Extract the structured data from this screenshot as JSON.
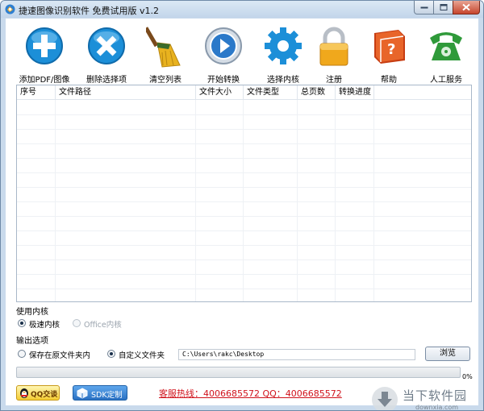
{
  "window": {
    "title": "捷速图像识别软件 免费试用版 v1.2"
  },
  "toolbar": [
    {
      "label": "添加PDF/图像",
      "icon": "add-icon",
      "color": "#1c8fd8"
    },
    {
      "label": "删除选择项",
      "icon": "delete-icon",
      "color": "#1c8fd8"
    },
    {
      "label": "清空列表",
      "icon": "broom-icon",
      "color": "#e8b21f"
    },
    {
      "label": "开始转换",
      "icon": "play-icon",
      "color": "#1c6fc4"
    },
    {
      "label": "选择内核",
      "icon": "gear-icon",
      "color": "#1c8fd8"
    },
    {
      "label": "注册",
      "icon": "lock-icon",
      "color": "#f0a81c"
    },
    {
      "label": "帮助",
      "icon": "help-book-icon",
      "color": "#e06a1c"
    },
    {
      "label": "人工服务",
      "icon": "phone-icon",
      "color": "#2f9a3a"
    }
  ],
  "table": {
    "columns": [
      "序号",
      "文件路径",
      "文件大小",
      "文件类型",
      "总页数",
      "转换进度"
    ],
    "rows": []
  },
  "engine": {
    "title": "使用内核",
    "options": [
      {
        "label": "极速内核",
        "selected": true,
        "disabled": false
      },
      {
        "label": "Office内核",
        "selected": false,
        "disabled": true
      }
    ]
  },
  "output": {
    "title": "输出选项",
    "options": [
      {
        "label": "保存在原文件夹内",
        "selected": false
      },
      {
        "label": "自定义文件夹",
        "selected": true
      }
    ],
    "path": "C:\\Users\\rakc\\Desktop",
    "browse_label": "浏览"
  },
  "progress": {
    "value": 0,
    "label": "0%"
  },
  "footer": {
    "qq_label": "QQ交谈",
    "sdk_label": "SDK定制",
    "hotline": "客服热线：4006685572 QQ：4006685572"
  },
  "watermark": {
    "text": "当下软件园",
    "url": "downxia.com"
  },
  "colors": {
    "accent": "#1c8fd8",
    "hotline": "#d0121b",
    "frame": "#c9daec"
  }
}
